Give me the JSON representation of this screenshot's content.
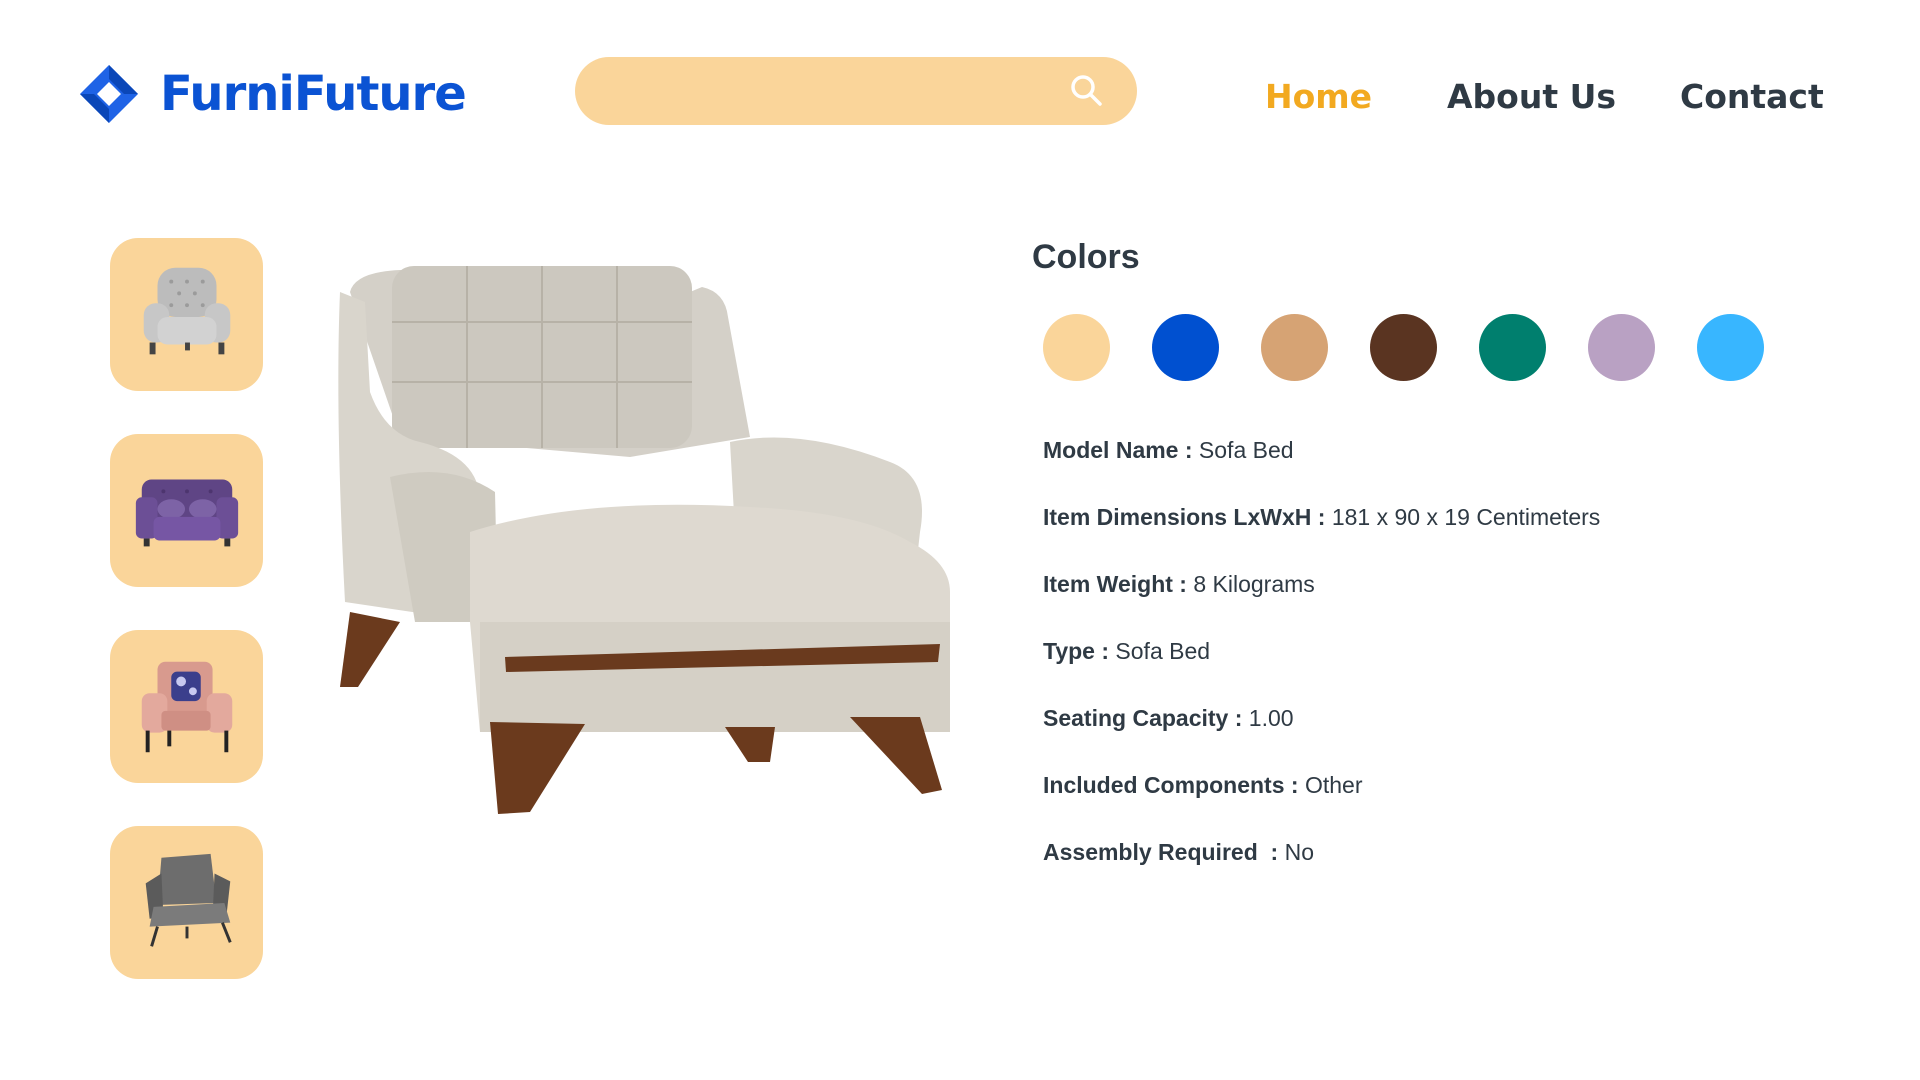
{
  "brand": {
    "name": "FurniFuture",
    "logo_icon": "diamond-logo-icon"
  },
  "search": {
    "placeholder": "",
    "value": "",
    "icon": "search-icon"
  },
  "nav": {
    "home": "Home",
    "about": "About Us",
    "contact": "Contact",
    "active": "Home"
  },
  "thumbnails": [
    {
      "name": "grey-tufted-armchair-thumbnail"
    },
    {
      "name": "purple-velvet-armchair-thumbnail"
    },
    {
      "name": "pink-leather-armchair-thumbnail"
    },
    {
      "name": "grey-wingback-chair-thumbnail"
    }
  ],
  "product_image": {
    "name": "beige-sofa-bed-armchair"
  },
  "colors": {
    "title": "Colors",
    "swatches": [
      "#fad59a",
      "#0050d0",
      "#d6a374",
      "#5a3421",
      "#007f6e",
      "#b9a1c3",
      "#38b6ff"
    ]
  },
  "details": [
    {
      "label": "Model Name : ",
      "value": "Sofa Bed"
    },
    {
      "label": "Item Dimensions LxWxH : ",
      "value": "181 x 90 x 19 Centimeters"
    },
    {
      "label": "Item Weight : ",
      "value": "8 Kilograms"
    },
    {
      "label": "Type : ",
      "value": "Sofa Bed"
    },
    {
      "label": "Seating Capacity : ",
      "value": "1.00"
    },
    {
      "label": "Included Components : ",
      "value": "Other"
    },
    {
      "label": "Assembly Required  : ",
      "value": "No"
    }
  ],
  "theme": {
    "accent": "#f2a920",
    "brand": "#0b53d3",
    "panel": "#fad59a",
    "text": "#2f3a44"
  }
}
